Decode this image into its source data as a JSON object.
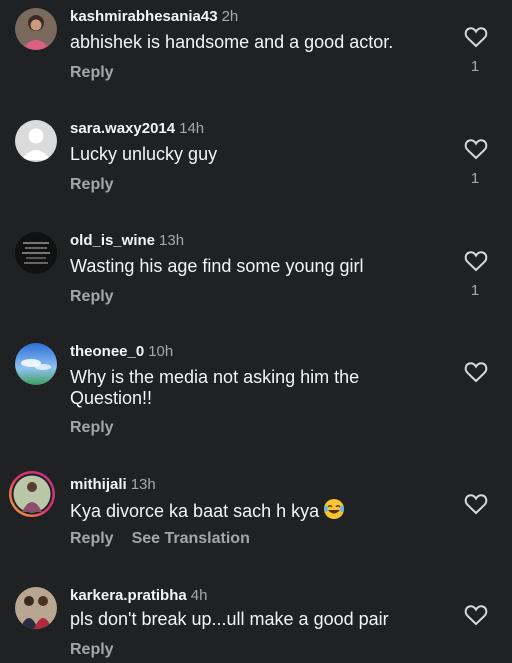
{
  "comments": [
    {
      "username": "kashmirabhesania43",
      "time": "2h",
      "text": "abhishek is handsome and a good actor.",
      "reply": "Reply",
      "likes": "1",
      "avatar": "photo-woman-pink"
    },
    {
      "username": "sara.waxy2014",
      "time": "14h",
      "text": "Lucky unlucky guy",
      "reply": "Reply",
      "likes": "1",
      "avatar": "default-user"
    },
    {
      "username": "old_is_wine",
      "time": "13h",
      "text": "Wasting his age find some young girl",
      "reply": "Reply",
      "likes": "1",
      "avatar": "dark-text-image"
    },
    {
      "username": "theonee_0",
      "time": "10h",
      "text": "Why is the media not asking him the Question!!",
      "reply": "Reply",
      "likes": "",
      "avatar": "blue-sky"
    },
    {
      "username": "mithijali",
      "time": "13h",
      "text": "Kya divorce ka baat sach h kya",
      "emoji": "laughing-tears-emoji",
      "reply": "Reply",
      "see_translation": "See Translation",
      "likes": "",
      "avatar": "story-ring-photo"
    },
    {
      "username": "karkera.pratibha",
      "time": "4h",
      "text": "pls don't break up...ull make a good pair",
      "reply": "Reply",
      "likes": "",
      "avatar": "photo-couple"
    }
  ],
  "colors": {
    "background": "#1f2123",
    "text": "#f4f4f4",
    "muted": "#a8a8a8",
    "story_ring": "#d6249f"
  }
}
